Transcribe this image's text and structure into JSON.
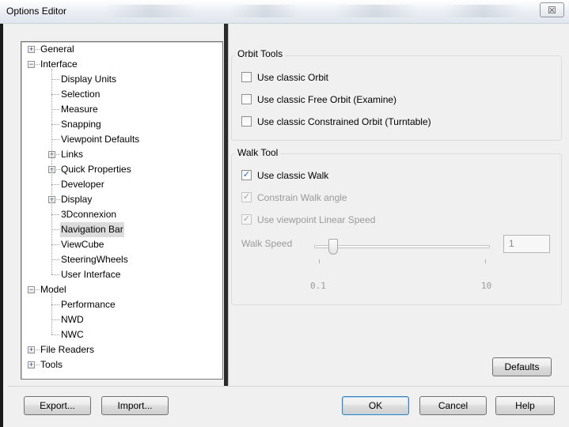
{
  "window": {
    "title": "Options Editor",
    "close_symbol": "☒"
  },
  "tree": {
    "items": [
      {
        "label": "General",
        "level": 0,
        "expander": "+"
      },
      {
        "label": "Interface",
        "level": 0,
        "expander": "−"
      },
      {
        "label": "Display Units",
        "level": 1,
        "expander": ""
      },
      {
        "label": "Selection",
        "level": 1,
        "expander": ""
      },
      {
        "label": "Measure",
        "level": 1,
        "expander": ""
      },
      {
        "label": "Snapping",
        "level": 1,
        "expander": ""
      },
      {
        "label": "Viewpoint Defaults",
        "level": 1,
        "expander": ""
      },
      {
        "label": "Links",
        "level": 1,
        "expander": "+"
      },
      {
        "label": "Quick Properties",
        "level": 1,
        "expander": "+"
      },
      {
        "label": "Developer",
        "level": 1,
        "expander": ""
      },
      {
        "label": "Display",
        "level": 1,
        "expander": "+"
      },
      {
        "label": "3Dconnexion",
        "level": 1,
        "expander": ""
      },
      {
        "label": "Navigation Bar",
        "level": 1,
        "expander": "",
        "selected": true
      },
      {
        "label": "ViewCube",
        "level": 1,
        "expander": ""
      },
      {
        "label": "SteeringWheels",
        "level": 1,
        "expander": ""
      },
      {
        "label": "User Interface",
        "level": 1,
        "expander": ""
      },
      {
        "label": "Model",
        "level": 0,
        "expander": "−"
      },
      {
        "label": "Performance",
        "level": 1,
        "expander": ""
      },
      {
        "label": "NWD",
        "level": 1,
        "expander": ""
      },
      {
        "label": "NWC",
        "level": 1,
        "expander": ""
      },
      {
        "label": "File Readers",
        "level": 0,
        "expander": "+"
      },
      {
        "label": "Tools",
        "level": 0,
        "expander": "+"
      }
    ]
  },
  "orbit": {
    "title": "Orbit Tools",
    "options": [
      {
        "label": "Use classic Orbit",
        "checked": false
      },
      {
        "label": "Use classic Free Orbit (Examine)",
        "checked": false
      },
      {
        "label": "Use classic Constrained Orbit (Turntable)",
        "checked": false
      }
    ]
  },
  "walk": {
    "title": "Walk Tool",
    "use_classic": {
      "label": "Use classic Walk",
      "checked": true
    },
    "constrain": {
      "label": "Constrain Walk angle",
      "checked": true,
      "disabled": true
    },
    "linear_speed": {
      "label": "Use viewpoint Linear Speed",
      "checked": true,
      "disabled": true
    },
    "speed_label": "Walk Speed",
    "speed_value": "1",
    "speed_min": "0.1",
    "speed_max": "10",
    "slider_fraction": 0.1
  },
  "buttons": {
    "defaults": "Defaults",
    "export": "Export...",
    "import": "Import...",
    "ok": "OK",
    "cancel": "Cancel",
    "help": "Help"
  },
  "check_glyph": "✓"
}
